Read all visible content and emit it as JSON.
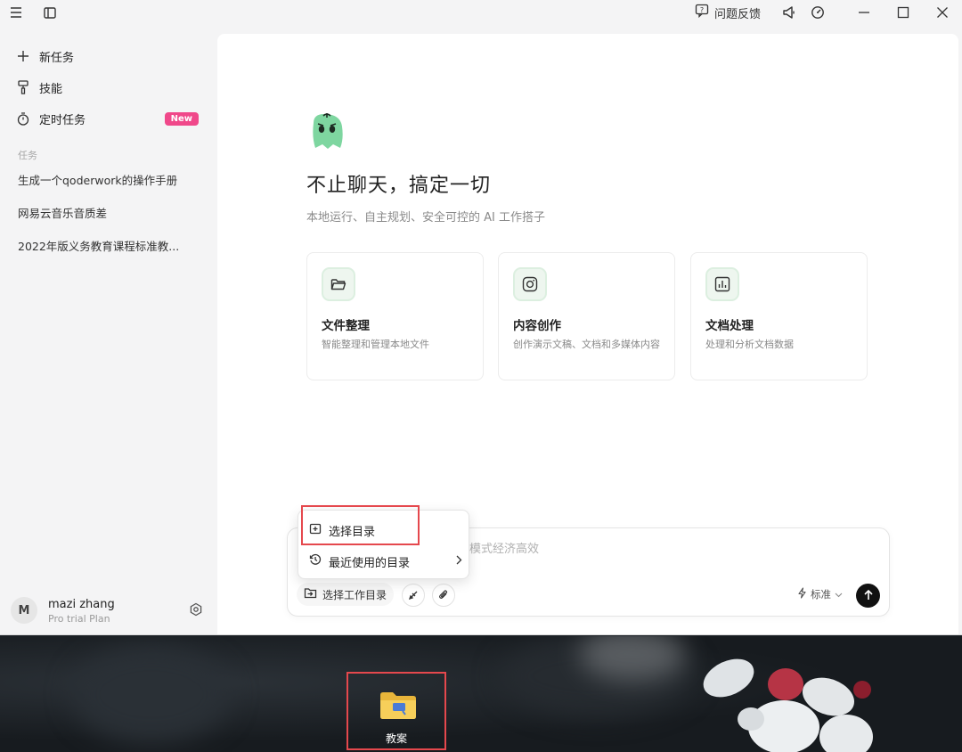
{
  "titlebar": {
    "feedback_label": "问题反馈",
    "icons": [
      "menu-icon",
      "sidebar-toggle-icon",
      "feedback-icon",
      "megaphone-icon",
      "gauge-icon",
      "minimize-icon",
      "maximize-icon",
      "close-icon"
    ]
  },
  "sidebar": {
    "items": [
      {
        "label": "新任务",
        "icon": "plus-icon"
      },
      {
        "label": "技能",
        "icon": "brush-icon"
      },
      {
        "label": "定时任务",
        "icon": "timer-icon",
        "badge": "New"
      }
    ],
    "section_label": "任务",
    "tasks": [
      "生成一个qoderwork的操作手册",
      "网易云音乐音质差",
      "2022年版义务教育课程标准教..."
    ],
    "user": {
      "initial": "M",
      "name": "mazi zhang",
      "plan": "Pro trial Plan"
    }
  },
  "main": {
    "headline": "不止聊天，搞定一切",
    "subline": "本地运行、自主规划、安全可控的 AI 工作搭子",
    "cards": [
      {
        "title": "文件整理",
        "desc": "智能整理和管理本地文件",
        "icon": "folder-open-icon"
      },
      {
        "title": "内容创作",
        "desc": "创作演示文稿、文档和多媒体内容",
        "icon": "instagram-icon"
      },
      {
        "title": "文档处理",
        "desc": "处理和分析文档数据",
        "icon": "chart-icon"
      }
    ],
    "chat": {
      "placeholder_visible": "模式经济高效",
      "dir_button": "选择工作目录",
      "mode": "标准"
    }
  },
  "popup": {
    "items": [
      {
        "label": "选择目录",
        "icon": "folder-plus-icon"
      },
      {
        "label": "最近使用的目录",
        "icon": "history-icon"
      }
    ]
  },
  "desktop": {
    "folder_label": "教案"
  },
  "colors": {
    "accent_badge": "#f0488a",
    "highlight": "#e5484d",
    "logo_green": "#7ed6a0"
  }
}
